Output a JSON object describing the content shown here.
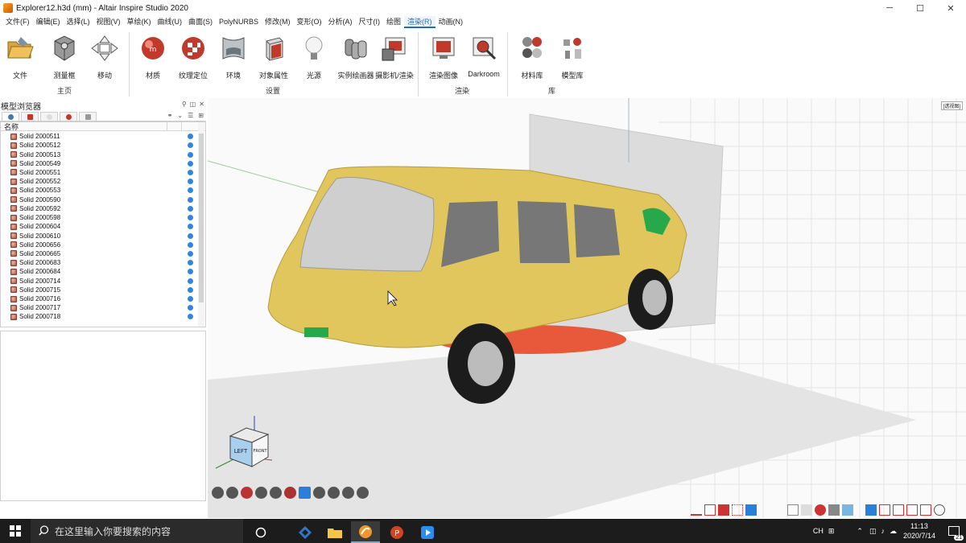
{
  "window": {
    "title": "Explorer12.h3d (mm) - Altair Inspire Studio 2020",
    "controls": {
      "minimize": "─",
      "maximize": "☐",
      "close": "✕"
    }
  },
  "menu": [
    "文件(F)",
    "编辑(E)",
    "选择(L)",
    "视图(V)",
    "草绘(K)",
    "曲线(U)",
    "曲面(S)",
    "PolyNURBS",
    "修改(M)",
    "变形(O)",
    "分析(A)",
    "尺寸(I)",
    "绘图",
    "渲染(R)",
    "动画(N)"
  ],
  "menu_active": "渲染(R)",
  "ribbon": {
    "buttons": [
      "文件",
      "测量框",
      "移动",
      "材质",
      "纹理定位",
      "环境",
      "对象属性",
      "光源",
      "实例绘画器",
      "摄影机/渲染",
      "渲染图像",
      "Darkroom",
      "材料库",
      "模型库"
    ],
    "groups": [
      "主页",
      "设置",
      "渲染",
      "库"
    ]
  },
  "browser": {
    "title": "模型浏览器",
    "col_name": "名称",
    "items": [
      "Solid 2000511",
      "Solid 2000512",
      "Solid 2000513",
      "Solid 2000549",
      "Solid 2000551",
      "Solid 2000552",
      "Solid 2000553",
      "Solid 2000590",
      "Solid 2000592",
      "Solid 2000598",
      "Solid 2000604",
      "Solid 2000610",
      "Solid 2000656",
      "Solid 2000665",
      "Solid 2000683",
      "Solid 2000684",
      "Solid 2000714",
      "Solid 2000715",
      "Solid 2000716",
      "Solid 2000717",
      "Solid 2000718"
    ]
  },
  "viewport": {
    "corner_tag": "[透视图]",
    "viewcube_left": "LEFT",
    "viewcube_front": "FRONT",
    "car_color": "#e0c65c",
    "ground_color": "#e4e4e4"
  },
  "taskbar": {
    "search_placeholder": "在这里输入你要搜索的内容",
    "ime": "CH",
    "time": "11:13",
    "date": "2020/7/14",
    "notifications": "21"
  }
}
